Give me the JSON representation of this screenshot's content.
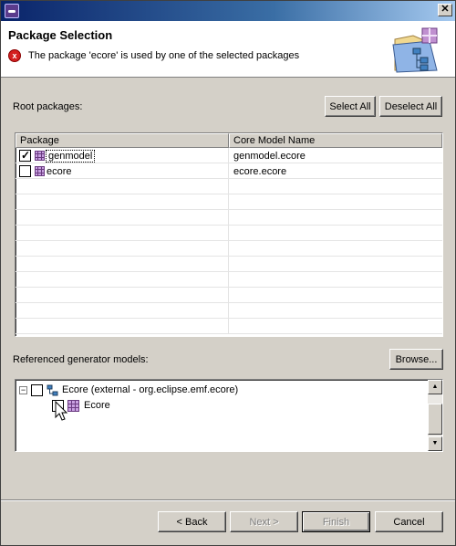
{
  "window": {
    "close_glyph": "✕"
  },
  "header": {
    "title": "Package Selection",
    "error_glyph": "x",
    "error_message": "The package 'ecore' is used by one of the selected packages"
  },
  "root_packages": {
    "label": "Root packages:",
    "select_all": "Select All",
    "deselect_all": "Deselect All",
    "columns": [
      "Package",
      "Core Model Name"
    ],
    "rows": [
      {
        "package": "genmodel",
        "core_model_name": "genmodel.ecore",
        "checked": true
      },
      {
        "package": "ecore",
        "core_model_name": "ecore.ecore",
        "checked": false
      }
    ]
  },
  "referenced": {
    "label": "Referenced generator models:",
    "browse": "Browse...",
    "tree": {
      "root_expander": "−",
      "root_label": "Ecore (external - org.eclipse.emf.ecore)",
      "child_label": "Ecore"
    },
    "scroll_up": "▲",
    "scroll_down": "▼"
  },
  "footer": {
    "back": "< Back",
    "next": "Next >",
    "finish": "Finish",
    "cancel": "Cancel"
  }
}
